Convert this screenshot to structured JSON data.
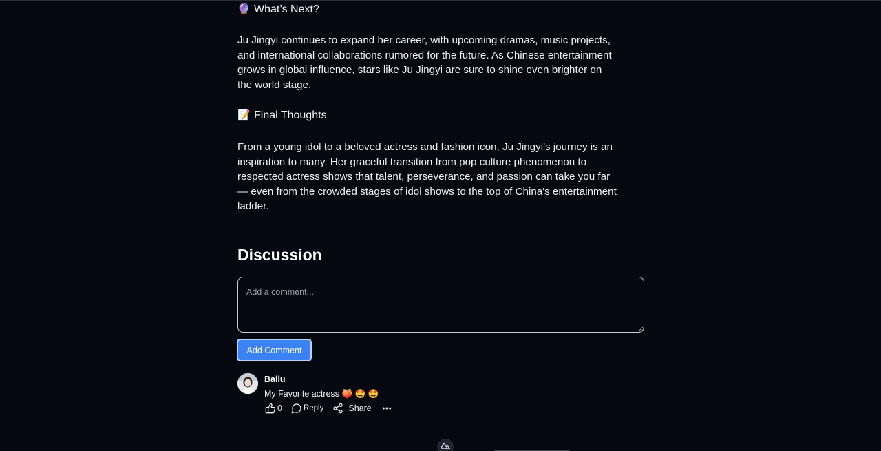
{
  "article": {
    "whats_next": {
      "emoji": "🔮",
      "heading": "What’s Next?",
      "lines": [
        "Ju Jingyi continues to expand her career, with upcoming dramas, music projects,",
        "and international collaborations rumored for the future. As Chinese entertainment",
        "grows in global influence, stars like Ju Jingyi are sure to shine even brighter on",
        "the world stage."
      ]
    },
    "final_thoughts": {
      "emoji": "📝",
      "heading": "Final Thoughts",
      "lines": [
        "From a young idol to a beloved actress and fashion icon, Ju Jingyi's journey is an",
        "inspiration to many. Her graceful transition from pop culture phenomenon to",
        "respected actress shows that talent, perseverance, and passion can take you far",
        "— even from the crowded stages of idol shows to the top of China's entertainment",
        "ladder."
      ]
    }
  },
  "discussion": {
    "title": "Discussion",
    "comment_placeholder": "Add a comment...",
    "comment_value": "",
    "add_button_label": "Add Comment",
    "comments": [
      {
        "author": "Bailu",
        "avatar_icon": "user-avatar-photo",
        "text": "My Favorite actress 🍑 🤩 🤩",
        "likes": "0",
        "reply_label": "Reply",
        "share_label": "Share",
        "like_icon": "thumbs-up-icon",
        "reply_icon": "chat-bubble-icon",
        "share_icon": "share-icon",
        "more_icon": "more-dots-icon"
      }
    ]
  },
  "footer": {
    "badge_icon": "nuxt-logo-icon"
  },
  "colors": {
    "background": "#060810",
    "text": "#eef0f3",
    "accent": "#3b82f6",
    "border": "#c8ccd3"
  }
}
